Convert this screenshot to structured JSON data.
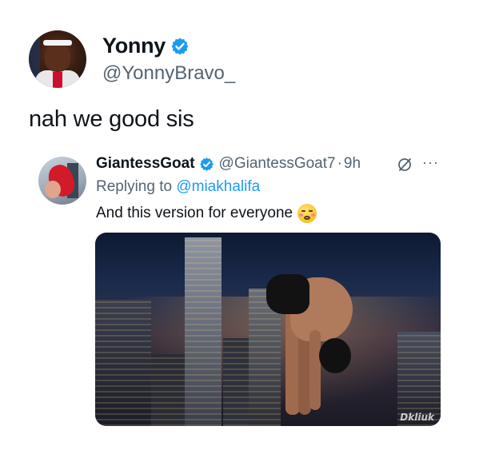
{
  "tweet": {
    "display_name": "Yonny",
    "handle": "@YonnyBravo_",
    "text": "nah we good sis",
    "verified_color": "#1d9bf0"
  },
  "quoted": {
    "display_name": "GiantessGoat",
    "handle": "@GiantessGoat7",
    "separator": "·",
    "time": "9h",
    "replying_prefix": "Replying to",
    "replying_mention": "@miakhalifa",
    "text": "And this version for everyone",
    "more_label": "···",
    "media_watermark": "Dkliuk"
  },
  "icons": {
    "verified": "verified-badge-icon",
    "emoji": "anguished-face-emoji-icon",
    "quote_action": "circle-slash-icon",
    "more": "more-options-icon"
  },
  "colors": {
    "text_primary": "#0f1419",
    "text_secondary": "#536471",
    "link": "#1d9bf0"
  }
}
